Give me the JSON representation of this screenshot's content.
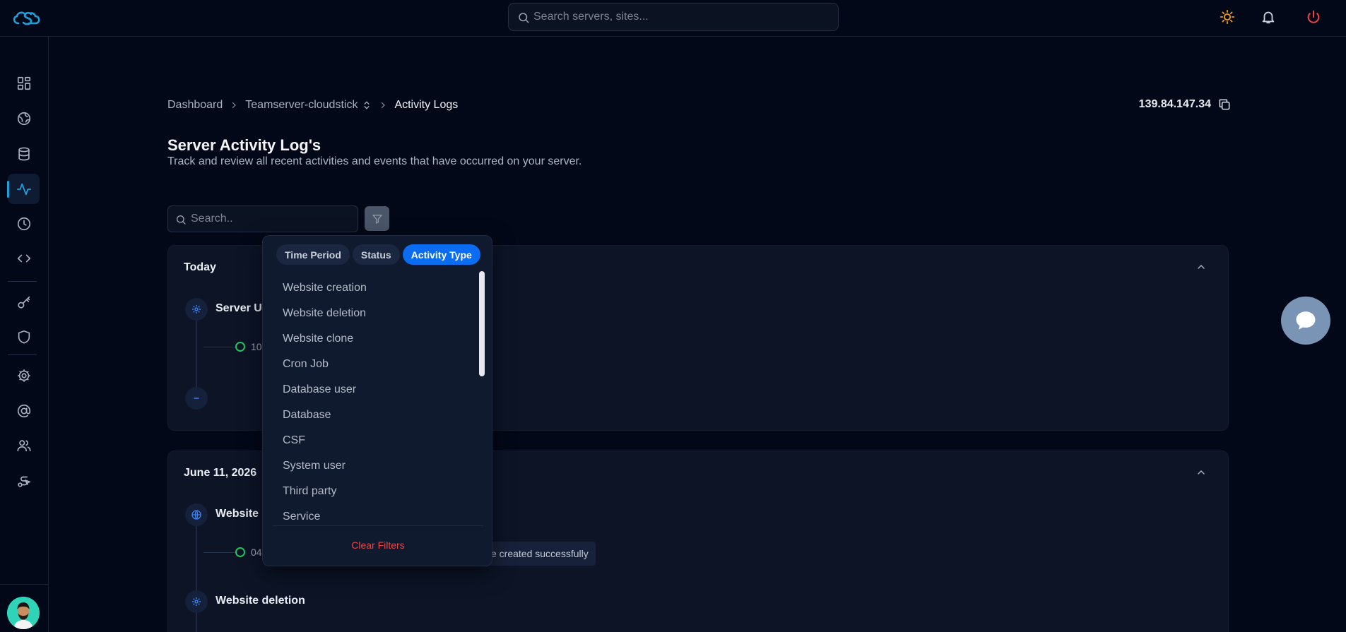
{
  "topbar": {
    "logo_name": "cloudstick-logo",
    "search_placeholder": "Search servers, sites...",
    "icons": [
      "sun-icon",
      "bell-icon",
      "power-icon"
    ],
    "colors": {
      "sun": "#f59e0b",
      "power": "#ef4444",
      "logo": "#1e9fd8"
    }
  },
  "sidebar": {
    "items": [
      {
        "name": "dashboard",
        "icon": "grid-icon",
        "active": false
      },
      {
        "name": "websites",
        "icon": "globe-icon",
        "active": false
      },
      {
        "name": "databases",
        "icon": "database-icon",
        "active": false
      },
      {
        "name": "activity",
        "icon": "activity-icon",
        "active": true
      },
      {
        "name": "cron-jobs",
        "icon": "clock-icon",
        "active": false
      },
      {
        "name": "code",
        "icon": "code-icon",
        "active": false
      },
      {
        "name": "ssh-keys",
        "icon": "key-icon",
        "active": false
      },
      {
        "name": "security",
        "icon": "shield-icon",
        "active": false
      },
      {
        "name": "settings",
        "icon": "gear-icon",
        "active": false
      },
      {
        "name": "email",
        "icon": "at-icon",
        "active": false
      },
      {
        "name": "users",
        "icon": "users-icon",
        "active": false
      },
      {
        "name": "routing",
        "icon": "route-icon",
        "active": false
      }
    ],
    "accent": "#1e9fd8"
  },
  "breadcrumb": {
    "items": [
      "Dashboard",
      "Teamserver-cloudstick",
      "Activity Logs"
    ]
  },
  "server_ip": "139.84.147.34",
  "page": {
    "title": "Server Activity Log's",
    "subtitle": "Track and review all recent activities and events that have occurred on your server."
  },
  "log_search": {
    "placeholder": "Search.."
  },
  "groups": [
    {
      "date": "Today",
      "events": [
        {
          "title": "Server Up",
          "time": "10"
        }
      ]
    },
    {
      "date": "June 11, 2026",
      "events": [
        {
          "title": "Website c",
          "time": "04",
          "message": "e created successfully"
        },
        {
          "title": "Website deletion"
        }
      ]
    }
  ],
  "filter_dropdown": {
    "tabs": [
      {
        "label": "Time Period",
        "active": false
      },
      {
        "label": "Status",
        "active": false
      },
      {
        "label": "Activity Type",
        "active": true
      }
    ],
    "options": [
      "Website creation",
      "Website deletion",
      "Website clone",
      "Cron Job",
      "Database user",
      "Database",
      "CSF",
      "System user",
      "Third party",
      "Service"
    ],
    "clear_label": "Clear Filters",
    "active_color": "#0a6cf0",
    "clear_color": "#ef4444"
  },
  "chat_widget": {
    "icon": "chat-icon"
  }
}
